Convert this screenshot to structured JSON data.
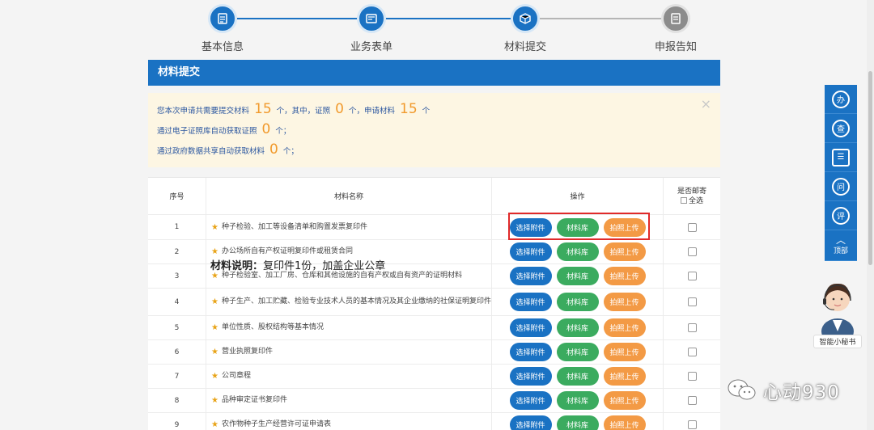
{
  "steps": [
    {
      "label": "基本信息",
      "icon": "document-icon"
    },
    {
      "label": "业务表单",
      "icon": "form-icon"
    },
    {
      "label": "材料提交",
      "icon": "box-icon"
    },
    {
      "label": "申报告知",
      "icon": "notice-icon"
    }
  ],
  "panel": {
    "title": "材料提交"
  },
  "notice": {
    "line1_a": "您本次申请共需要提交材料",
    "total": "15",
    "line1_b": "个，其中，证照",
    "license_count": "0",
    "line1_c": "个，申请材料",
    "material_count": "15",
    "line1_d": "个",
    "line2_a": "通过电子证照库自动获取证照",
    "auto_license": "0",
    "line2_b": "个；",
    "line3_a": "通过政府数据共享自动获取材料",
    "auto_material": "0",
    "line3_b": "个；",
    "close": "×"
  },
  "table": {
    "headers": {
      "index": "序号",
      "name": "材料名称",
      "ops": "操作",
      "mail": "是否邮寄",
      "select_all": "全选"
    },
    "buttons": {
      "select": "选择附件",
      "library": "材料库",
      "upload": "拍照上传"
    },
    "rows": [
      {
        "index": "1",
        "name": "种子检验、加工等设备清单和购置发票复印件"
      },
      {
        "index": "2",
        "name": "办公场所自有产权证明复印件或租赁合同"
      },
      {
        "index": "3",
        "name": "种子检验室、加工厂房、仓库和其他设施的自有产权或自有资产的证明材料"
      },
      {
        "index": "4",
        "name": "种子生产、加工贮藏、检验专业技术人员的基本情况及其企业缴纳的社保证明复印件"
      },
      {
        "index": "5",
        "name": "单位性质、股权结构等基本情况"
      },
      {
        "index": "6",
        "name": "营业执照复印件"
      },
      {
        "index": "7",
        "name": "公司章程"
      },
      {
        "index": "8",
        "name": "品种审定证书复印件"
      },
      {
        "index": "9",
        "name": "农作物种子生产经营许可证申请表"
      }
    ]
  },
  "tooltip": {
    "label": "材料说明：",
    "text": "复印件1份，加盖企业公章"
  },
  "sidebar": {
    "items": [
      {
        "glyph": "办",
        "icon": "handle-icon"
      },
      {
        "glyph": "查",
        "icon": "query-icon"
      },
      {
        "glyph": "☰",
        "icon": "list-icon"
      },
      {
        "glyph": "问",
        "icon": "question-icon"
      },
      {
        "glyph": "评",
        "icon": "rate-icon"
      }
    ],
    "top_label": "顶部",
    "assistant": "智能小秘书"
  },
  "watermark": "心动930",
  "colors": {
    "primary": "#1a72c3",
    "green": "#3bab5f",
    "orange": "#f39a45",
    "highlight": "#e02a2a"
  }
}
